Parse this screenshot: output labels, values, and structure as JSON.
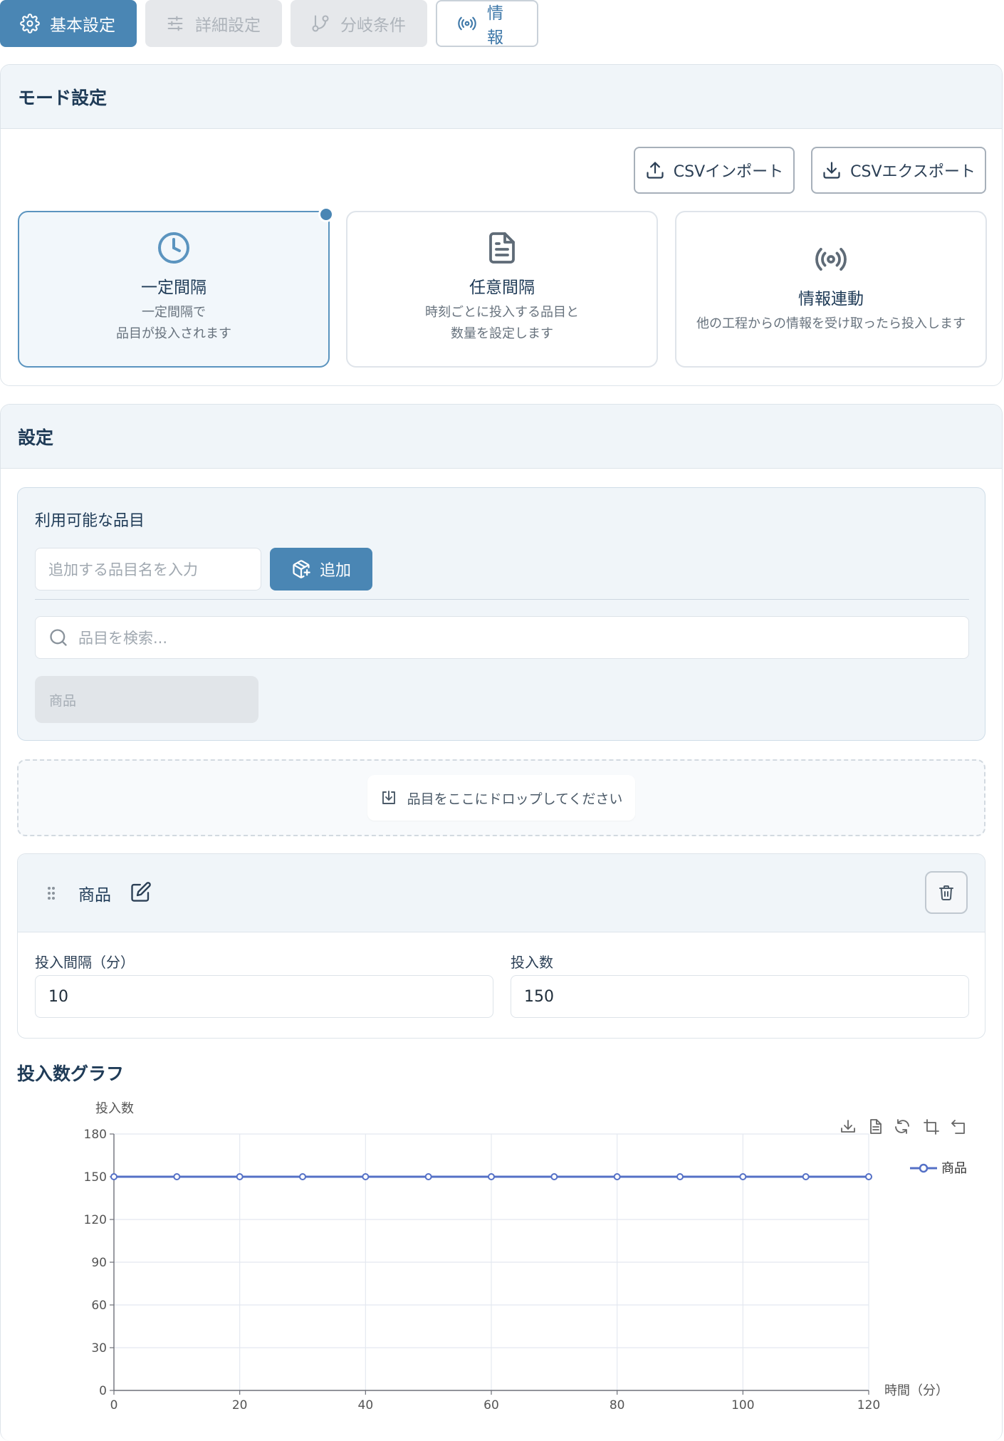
{
  "tabs": [
    {
      "label": "基本設定",
      "icon": "gear-icon",
      "state": "active"
    },
    {
      "label": "詳細設定",
      "icon": "sliders-icon",
      "state": "disabled"
    },
    {
      "label": "分岐条件",
      "icon": "git-branch-icon",
      "state": "disabled"
    },
    {
      "label": "情報",
      "icon": "radio-icon",
      "state": "outline"
    }
  ],
  "mode_panel": {
    "title": "モード設定",
    "csv_import": "CSVインポート",
    "csv_export": "CSVエクスポート",
    "modes": [
      {
        "title": "一定間隔",
        "desc1": "一定間隔で",
        "desc2": "品目が投入されます",
        "icon": "clock-icon",
        "selected": true
      },
      {
        "title": "任意間隔",
        "desc1": "時刻ごとに投入する品目と",
        "desc2": "数量を設定します",
        "icon": "document-icon",
        "selected": false
      },
      {
        "title": "情報連動",
        "desc1": "他の工程からの情報を受け取ったら投入します",
        "desc2": "",
        "icon": "radio-icon",
        "selected": false
      }
    ]
  },
  "settings_panel": {
    "title": "設定",
    "available_items_label": "利用可能な品目",
    "add_item_placeholder": "追加する品目名を入力",
    "add_button": "追加",
    "search_placeholder": "品目を検索...",
    "available_items": [
      "商品"
    ],
    "drop_text": "品目をここにドロップしてください",
    "item": {
      "name": "商品",
      "interval_label": "投入間隔（分）",
      "interval_value": "10",
      "count_label": "投入数",
      "count_value": "150"
    }
  },
  "chart_title": "投入数グラフ",
  "chart_data": {
    "type": "line",
    "ylabel": "投入数",
    "xlabel": "時間（分）",
    "x": [
      0,
      10,
      20,
      30,
      40,
      50,
      60,
      70,
      80,
      90,
      100,
      110,
      120
    ],
    "series": [
      {
        "name": "商品",
        "values": [
          150,
          150,
          150,
          150,
          150,
          150,
          150,
          150,
          150,
          150,
          150,
          150,
          150
        ],
        "color": "#5470c6"
      }
    ],
    "xlim": [
      0,
      120
    ],
    "ylim": [
      0,
      180
    ],
    "xticks": [
      0,
      20,
      40,
      60,
      80,
      100,
      120
    ],
    "yticks": [
      0,
      30,
      60,
      90,
      120,
      150,
      180
    ],
    "grid": true,
    "legend": "top-right"
  },
  "colors": {
    "accent": "#4a86b4",
    "series": "#5470c6"
  }
}
